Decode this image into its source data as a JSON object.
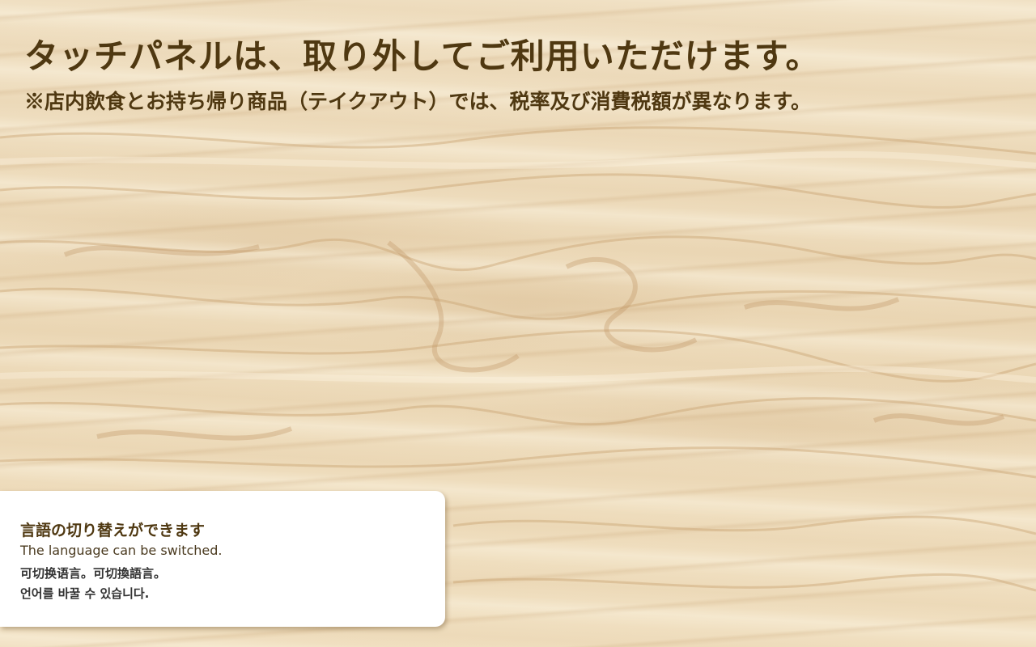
{
  "screen": {
    "background": "light-oak-wood-grain",
    "text_color": "#4f3811"
  },
  "notice": {
    "headline": "タッチパネルは、取り外してご利用いただけます。",
    "tax_note": "※店内飲食とお持ち帰り商品（テイクアウト）では、税率及び消費税額が異なります。"
  },
  "language_switch": {
    "label_ja": "言語の切り替えができます",
    "label_en": "The language can be switched.",
    "label_zh": "可切换语言。可切換語言。",
    "label_ko": "언어를 바꿀 수 있습니다."
  }
}
